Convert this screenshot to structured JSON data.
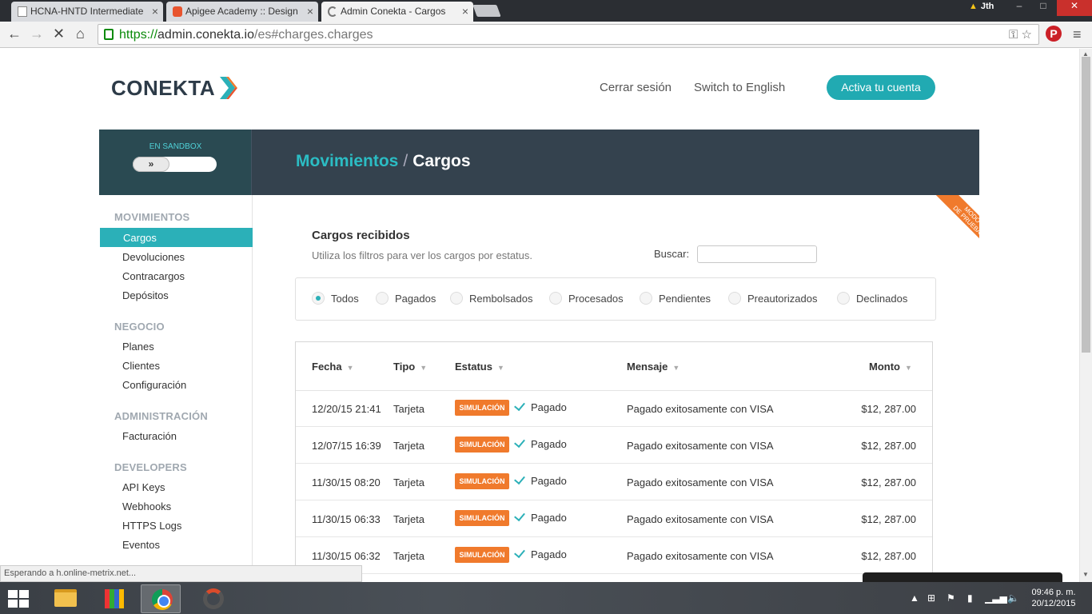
{
  "browser": {
    "tabs": [
      {
        "title": "HCNA-HNTD Intermediate",
        "icon": "document-icon"
      },
      {
        "title": "Apigee Academy :: Design",
        "icon": "apigee-icon"
      },
      {
        "title": "Admin Conekta - Cargos",
        "icon": "loading-icon"
      }
    ],
    "user": "Jth",
    "url_scheme": "https://",
    "url_host": "admin.conekta.io",
    "url_path": "/es#charges.charges",
    "status": "Esperando a h.online-metrix.net..."
  },
  "header": {
    "logo": "CONEKTA",
    "logout": "Cerrar sesión",
    "language": "Switch to English",
    "activate": "Activa tu cuenta"
  },
  "banner": {
    "sandbox_label": "EN SANDBOX",
    "toggle_glyph": "»",
    "breadcrumb_parent": "Movimientos",
    "breadcrumb_sep": "/",
    "breadcrumb_current": "Cargos"
  },
  "ribbon": {
    "line1": "MODO",
    "line2": "DE PRUEBA"
  },
  "sidebar": {
    "sections": [
      {
        "heading": "MOVIMIENTOS",
        "items": [
          "Cargos",
          "Devoluciones",
          "Contracargos",
          "Depósitos"
        ]
      },
      {
        "heading": "NEGOCIO",
        "items": [
          "Planes",
          "Clientes",
          "Configuración"
        ]
      },
      {
        "heading": "ADMINISTRACIÓN",
        "items": [
          "Facturación"
        ]
      },
      {
        "heading": "DEVELOPERS",
        "items": [
          "API Keys",
          "Webhooks",
          "HTTPS Logs",
          "Eventos"
        ]
      }
    ],
    "active": "Cargos"
  },
  "main": {
    "title": "Cargos recibidos",
    "description": "Utiliza los filtros para ver los cargos por estatus.",
    "search_label": "Buscar:",
    "search_value": "",
    "filters": [
      "Todos",
      "Pagados",
      "Rembolsados",
      "Procesados",
      "Pendientes",
      "Preautorizados",
      "Declinados"
    ],
    "selected_filter": "Todos"
  },
  "table": {
    "columns": [
      "Fecha",
      "Tipo",
      "Estatus",
      "Mensaje",
      "Monto"
    ],
    "rows": [
      {
        "fecha": "12/20/15 21:41",
        "tipo": "Tarjeta",
        "badge": "SIMULACIÓN",
        "estatus": "Pagado",
        "mensaje": "Pagado exitosamente con VISA",
        "monto": "$12, 287.00"
      },
      {
        "fecha": "12/07/15 16:39",
        "tipo": "Tarjeta",
        "badge": "SIMULACIÓN",
        "estatus": "Pagado",
        "mensaje": "Pagado exitosamente con VISA",
        "monto": "$12, 287.00"
      },
      {
        "fecha": "11/30/15 08:20",
        "tipo": "Tarjeta",
        "badge": "SIMULACIÓN",
        "estatus": "Pagado",
        "mensaje": "Pagado exitosamente con VISA",
        "monto": "$12, 287.00"
      },
      {
        "fecha": "11/30/15 06:33",
        "tipo": "Tarjeta",
        "badge": "SIMULACIÓN",
        "estatus": "Pagado",
        "mensaje": "Pagado exitosamente con VISA",
        "monto": "$12, 287.00"
      },
      {
        "fecha": "11/30/15 06:32",
        "tipo": "Tarjeta",
        "badge": "SIMULACIÓN",
        "estatus": "Pagado",
        "mensaje": "Pagado exitosamente con VISA",
        "monto": "$12, 287.00"
      }
    ]
  },
  "taskbar": {
    "time": "09:46 p. m.",
    "date": "20/12/2015"
  },
  "colors": {
    "accent": "#2bb0b8",
    "banner": "#34424e",
    "badge": "#f07a2c"
  }
}
